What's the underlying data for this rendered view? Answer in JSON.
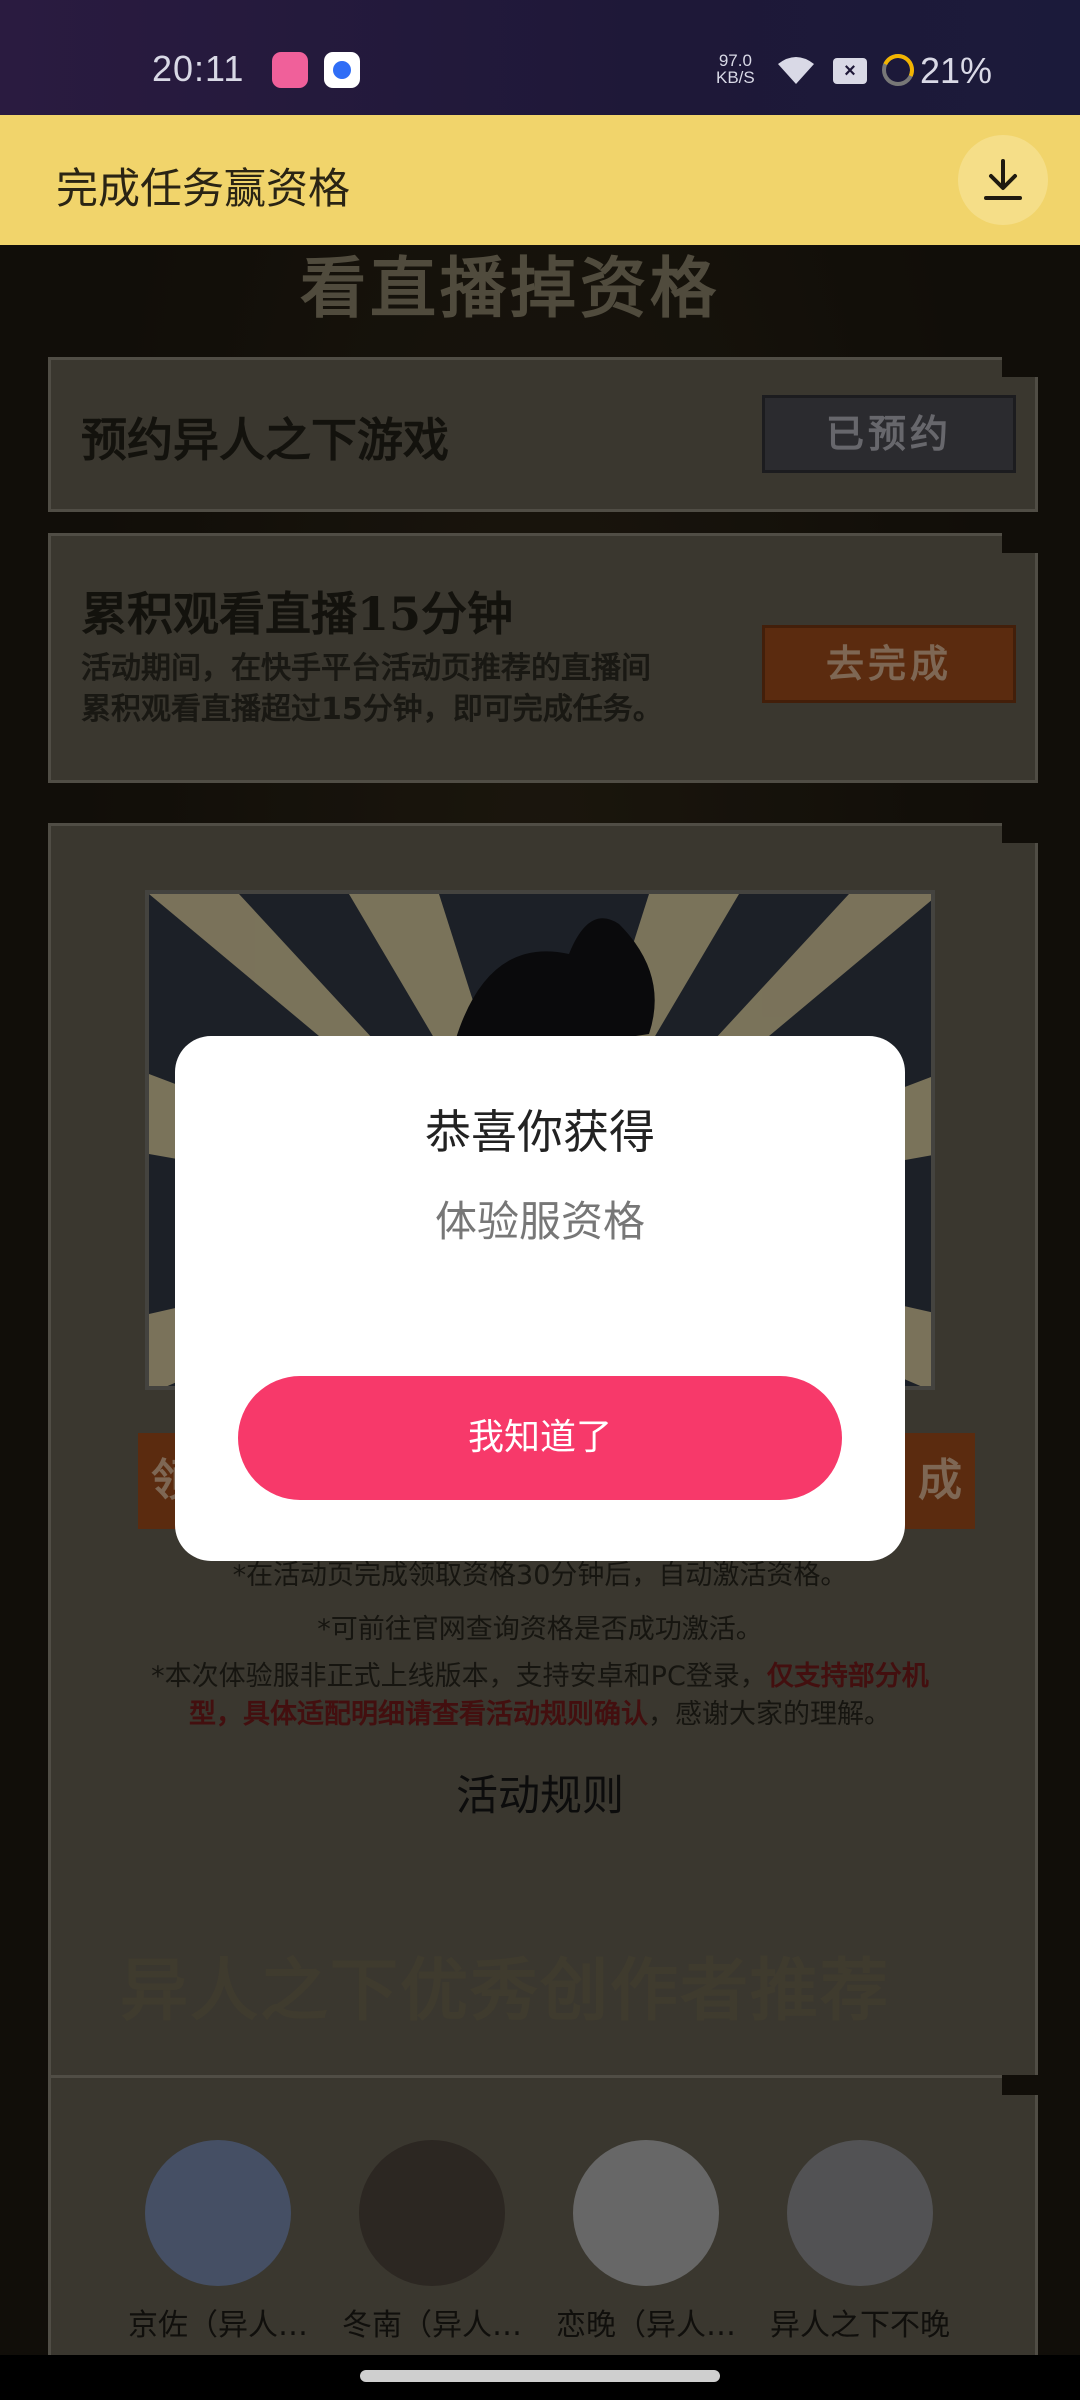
{
  "status_bar": {
    "time": "20:11",
    "net_speed_value": "97.0",
    "net_speed_unit": "KB/S",
    "battery": "21%"
  },
  "top_bar": {
    "title": "完成任务赢资格"
  },
  "section_heading_top": "看直播掉资格",
  "tasks": [
    {
      "title": "预约异人之下游戏",
      "button": "已预约"
    },
    {
      "title": "累积观看直播15分钟",
      "desc_line1": "活动期间，在快手平台活动页推荐的直播间",
      "desc_line2": "累积观看直播超过15分钟，即可完成任务。",
      "button": "去完成"
    }
  ],
  "reward_card": {
    "left_button_char": "领",
    "right_button_char": "成"
  },
  "notes": {
    "line1": "*在活动页完成领取资格30分钟后，自动激活资格。",
    "line2": "*可前往官网查询资格是否成功激活。",
    "line3_prefix": "*本次体验服非正式上线版本，支持安卓和PC登录，",
    "line3_highlight1": "仅支持部分机",
    "line4_highlight2": "型，具体适配明细请查看活动规则确认",
    "line4_suffix": "，感谢大家的理解。"
  },
  "rules_link": "活动规则",
  "section_heading_bottom": "异人之下优秀创作者推荐",
  "creators": [
    {
      "name": "京佐（异人…"
    },
    {
      "name": "冬南（异人…"
    },
    {
      "name": "恋晚（异人…"
    },
    {
      "name": "异人之下不晚"
    }
  ],
  "dialog": {
    "title": "恭喜你获得",
    "subtitle": "体验服资格",
    "confirm_button": "我知道了"
  },
  "colors": {
    "top_bar_bg": "#f1d46b",
    "dialog_button": "#f7396a",
    "highlight_text": "#5a1414"
  }
}
